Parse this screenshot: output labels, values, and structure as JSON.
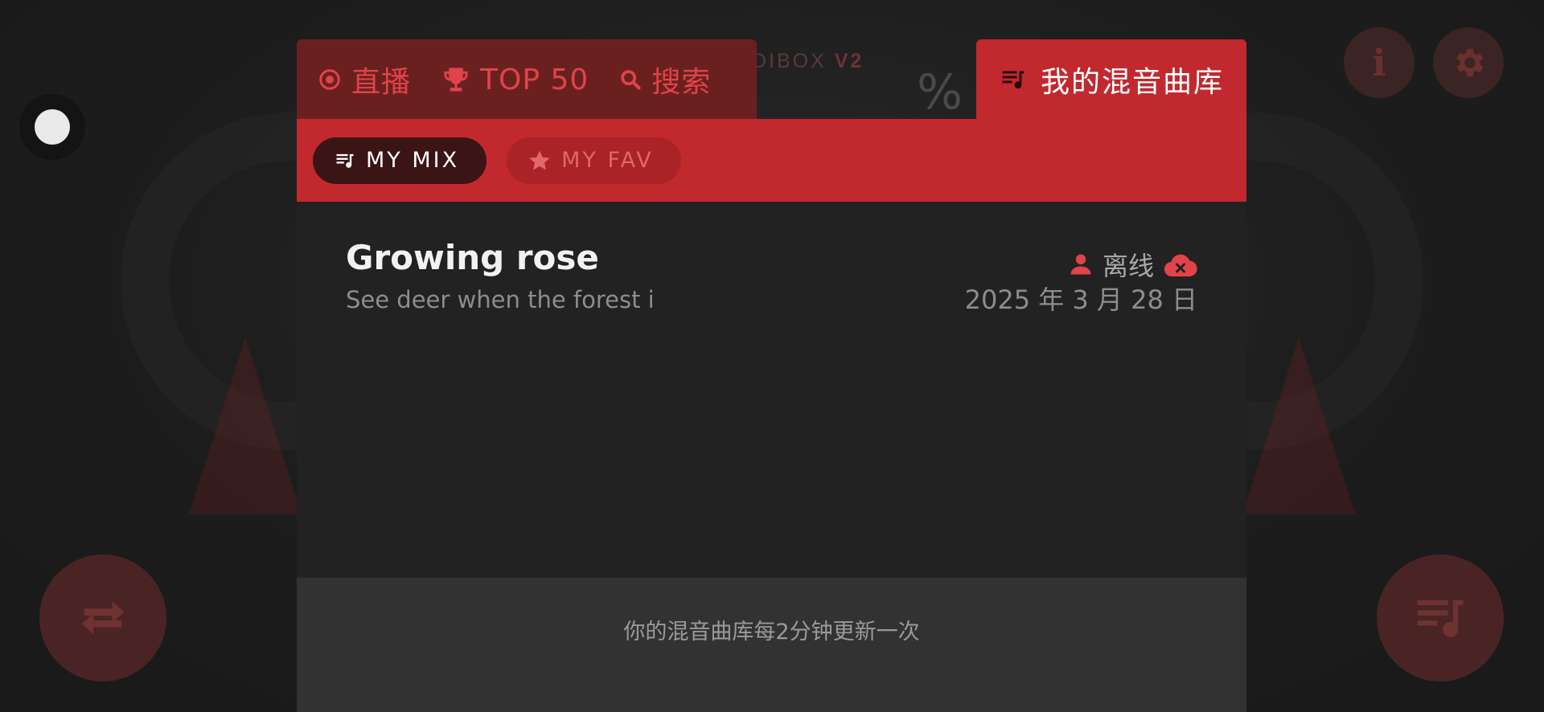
{
  "header": {
    "logo_text": "DIBOX",
    "logo_version": "V2",
    "logo_mark": "%"
  },
  "tabs": [
    {
      "label": "直播",
      "icon": "radio-dot-icon"
    },
    {
      "label": "TOP 50",
      "icon": "trophy-icon"
    },
    {
      "label": "搜索",
      "icon": "search-icon"
    }
  ],
  "active_tab": {
    "label": "我的混音曲库",
    "icon": "playlist-icon"
  },
  "subtabs": [
    {
      "label": "MY MIX",
      "icon": "playlist-icon",
      "active": true
    },
    {
      "label": "MY FAV",
      "icon": "star-icon",
      "active": false
    }
  ],
  "mixes": [
    {
      "title": "Growing rose",
      "subtitle": "See deer when the forest i",
      "status": "离线",
      "date": "2025 年 3 月 28 日"
    }
  ],
  "footer": {
    "note": "你的混音曲库每2分钟更新一次"
  },
  "colors": {
    "accent": "#c1292e",
    "accent_dark": "#6b2020",
    "tab_text": "#e0434a",
    "background": "#1c1c1c"
  }
}
